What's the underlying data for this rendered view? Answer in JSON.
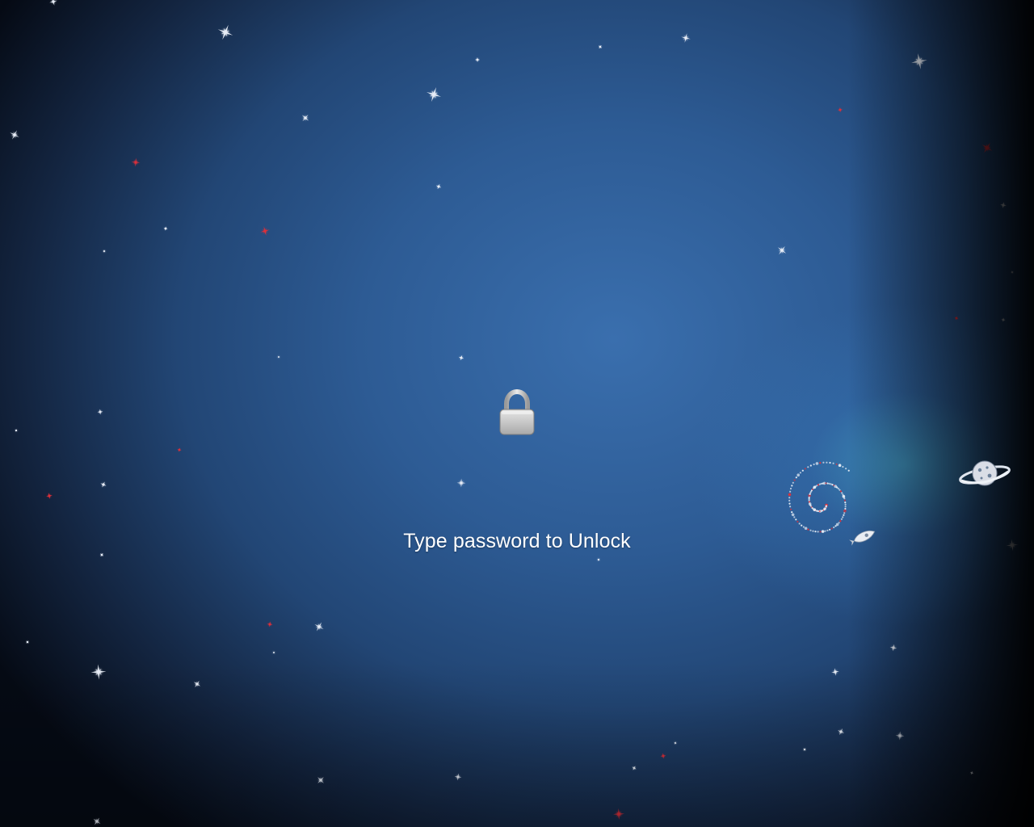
{
  "lock_screen": {
    "prompt": "Type password to Unlock",
    "password": {
      "value": "",
      "placeholder": ""
    }
  },
  "icons": {
    "lock": "lock-icon",
    "swirl": "debian-swirl-icon",
    "rocket": "rocket-icon",
    "planet": "planet-icon",
    "stars": "star-icon"
  },
  "colors": {
    "background_center": "#3a6fae",
    "background_edge": "#050a14",
    "star_white": "#e8eef7",
    "star_red": "#e0303a",
    "text": "#ffffff",
    "lock_body": "#c8c8c8"
  }
}
